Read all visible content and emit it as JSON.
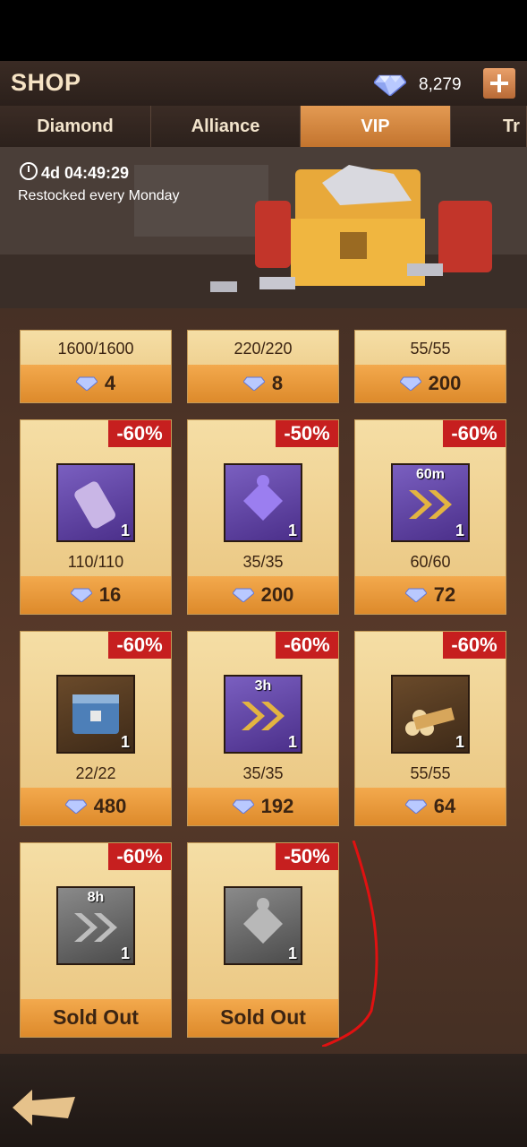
{
  "header": {
    "title": "SHOP",
    "diamonds": "8,279"
  },
  "tabs": [
    "Diamond",
    "Alliance",
    "VIP",
    "Tr"
  ],
  "banner": {
    "timer": "4d 04:49:29",
    "restock": "Restocked every Monday"
  },
  "top_row": [
    {
      "limit": "1600/1600",
      "price": "4"
    },
    {
      "limit": "220/220",
      "price": "8"
    },
    {
      "limit": "55/55",
      "price": "200"
    }
  ],
  "row2": [
    {
      "discount": "-60%",
      "qty": "1",
      "limit": "110/110",
      "price": "16",
      "icon": "bolt-spool-icon"
    },
    {
      "discount": "-50%",
      "qty": "1",
      "limit": "35/35",
      "price": "200",
      "icon": "puzzle-piece-icon"
    },
    {
      "discount": "-60%",
      "qty": "1",
      "limit": "60/60",
      "price": "72",
      "icon": "speedup-icon",
      "tag": "60m"
    }
  ],
  "row3": [
    {
      "discount": "-60%",
      "qty": "1",
      "limit": "22/22",
      "price": "480",
      "icon": "crate-icon"
    },
    {
      "discount": "-60%",
      "qty": "1",
      "limit": "35/35",
      "price": "192",
      "icon": "speedup-icon",
      "tag": "3h"
    },
    {
      "discount": "-60%",
      "qty": "1",
      "limit": "55/55",
      "price": "64",
      "icon": "wood-logs-icon"
    }
  ],
  "row4": [
    {
      "discount": "-60%",
      "qty": "1",
      "status": "Sold Out",
      "icon": "speedup-icon",
      "tag": "8h"
    },
    {
      "discount": "-50%",
      "qty": "1",
      "status": "Sold Out",
      "icon": "puzzle-piece-icon"
    }
  ]
}
